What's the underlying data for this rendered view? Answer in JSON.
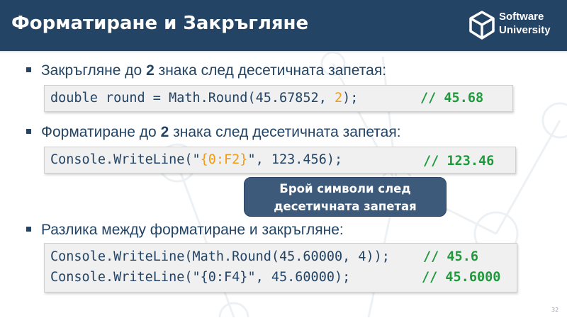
{
  "header": {
    "title": "Форматиране и Закръгляне",
    "logo": {
      "line1": "Software",
      "line2": "University"
    }
  },
  "bullets": [
    "Закръгляне до 2 знака след десетичната запетая:",
    "Форматиране до 2 знака след десетичната запетая:",
    "Разлика между форматиране и закръгляне:"
  ],
  "code1": {
    "pre": "double round = Math.Round(45.67852, ",
    "highlight": "2",
    "post": ");",
    "comment": "// 45.68"
  },
  "code2": {
    "pre": "Console.WriteLine(\"",
    "highlight": "{0:F2}",
    "post": "\", 123.456);",
    "comment": "// 123.46"
  },
  "code3": [
    {
      "text": "Console.WriteLine(Math.Round(45.60000, 4));",
      "comment": "// 45.6"
    },
    {
      "text": "Console.WriteLine(\"{0:F4}\", 45.60000);",
      "comment": "// 45.6000"
    }
  ],
  "callout": {
    "line1": "Брой символи след",
    "line2": "десетичната запетая"
  },
  "page_number": "32",
  "colors": {
    "header": "#234465",
    "text": "#234465",
    "comment": "#1e9a3c",
    "highlight": "#f39c12",
    "callout": "#3d5a7a"
  },
  "icons": {
    "logo": "software-university-logo-icon",
    "bullet": "square-bullet-icon"
  }
}
